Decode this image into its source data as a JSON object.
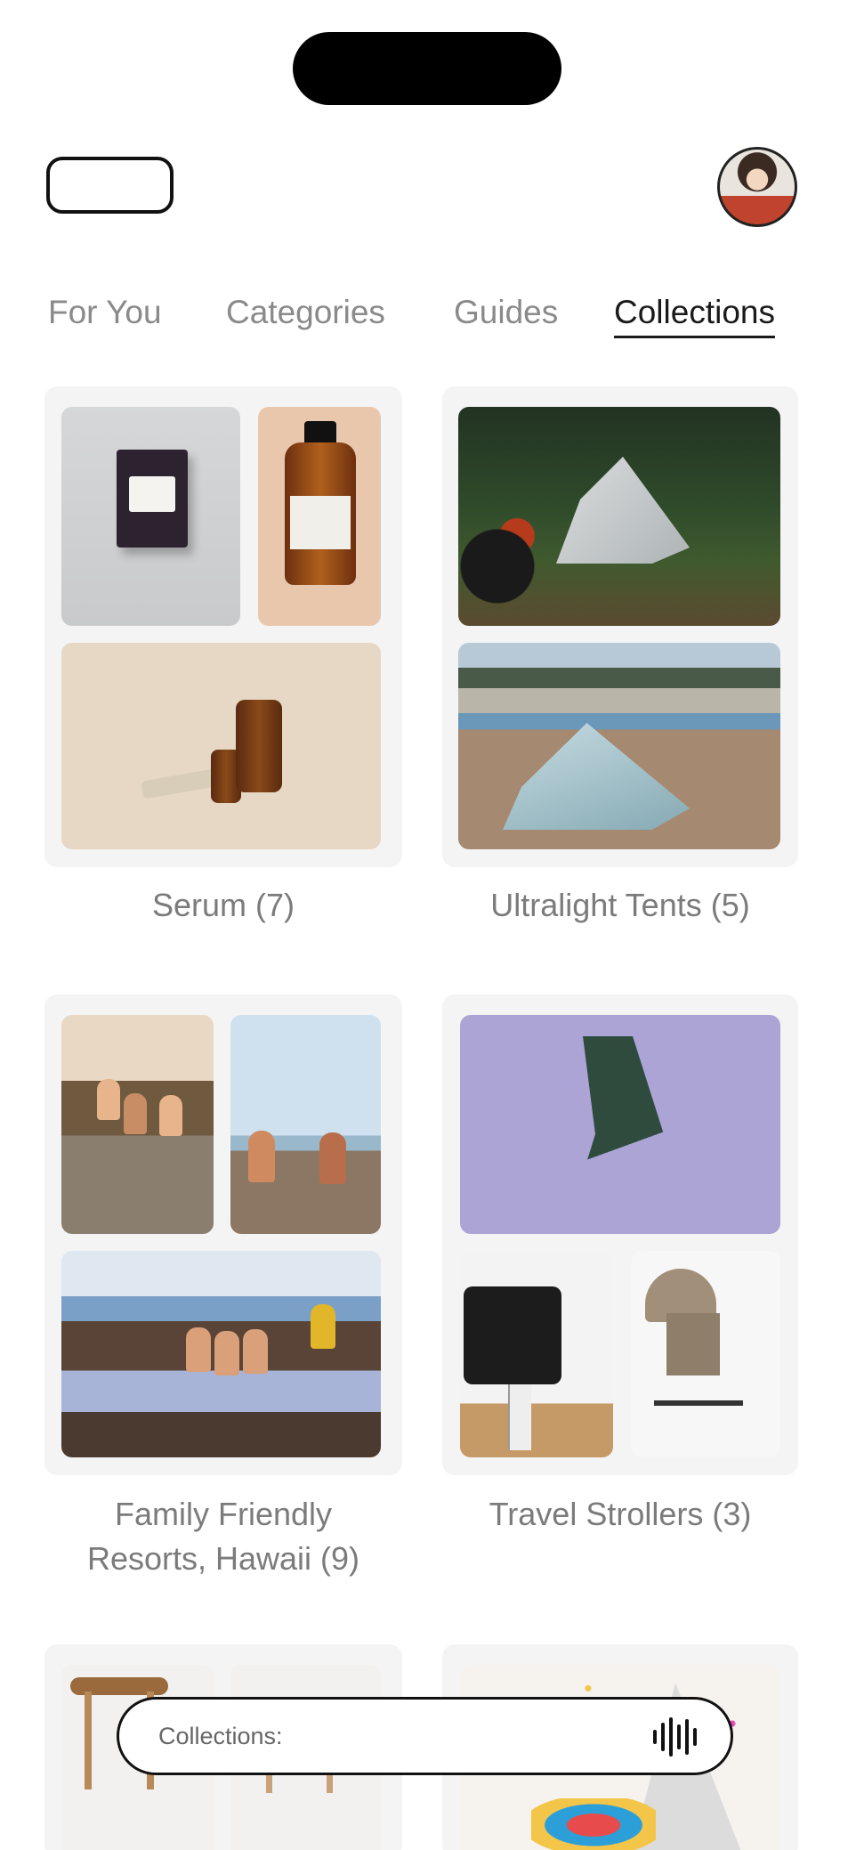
{
  "tabs": [
    {
      "label": "For You",
      "active": false
    },
    {
      "label": "Categories",
      "active": false
    },
    {
      "label": "Guides",
      "active": false
    },
    {
      "label": "Collections",
      "active": true
    }
  ],
  "collections": [
    {
      "title": "Serum (7)"
    },
    {
      "title": "Ultralight Tents (5)"
    },
    {
      "title_line1": "Family Friendly",
      "title_line2": "Resorts, Hawaii (9)"
    },
    {
      "title": "Travel Strollers (3)"
    },
    {
      "title": ""
    },
    {
      "title": ""
    }
  ],
  "search": {
    "placeholder": "Collections:"
  },
  "icons": {
    "voice": "voice-waveform-icon",
    "avatar": "user-avatar"
  },
  "colors": {
    "active_tab": "#1a1a1a",
    "inactive_tab": "#8a8a8a",
    "card_bg": "#f4f4f4",
    "caption": "#7b7b7b"
  }
}
